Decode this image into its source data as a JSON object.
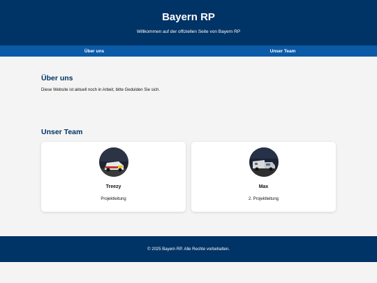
{
  "header": {
    "title": "Bayern RP",
    "subtitle": "Willkommen auf der offiziellen Seite von Bayern RP"
  },
  "nav": {
    "items": [
      {
        "label": "Über uns"
      },
      {
        "label": "Unser Team"
      }
    ]
  },
  "about": {
    "title": "Über uns",
    "text": "Diese Website ist aktuell noch in Arbeit, bitte Gedulden Sie sich."
  },
  "team": {
    "title": "Unser Team",
    "members": [
      {
        "name": "Treezy",
        "role": "Projektleitung"
      },
      {
        "name": "Max",
        "role": "2. Projektleitung"
      }
    ]
  },
  "footer": {
    "text": "© 2025 Bayern RP. Alle Rechte vorbehalten."
  },
  "colors": {
    "primary": "#003366",
    "nav": "#0a5aa8",
    "background": "#f4f4f4"
  }
}
